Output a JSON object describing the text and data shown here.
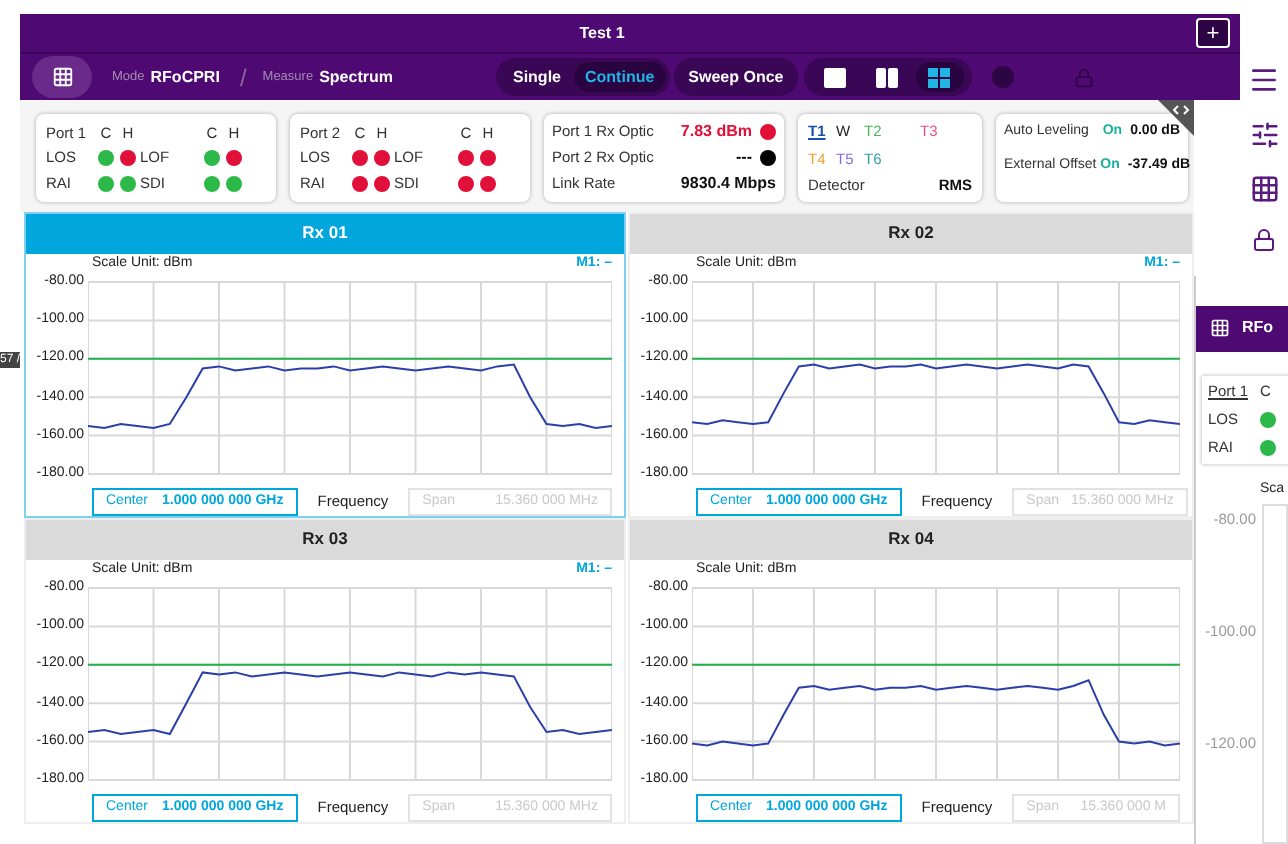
{
  "window": {
    "title": "Test 1",
    "add_button": "+"
  },
  "toolbar": {
    "mode_label": "Mode",
    "mode": "RFoCPRI",
    "separator": "/",
    "measure_label": "Measure",
    "measure": "Spectrum",
    "sweep_modes": [
      {
        "label": "Single",
        "selected": false
      },
      {
        "label": "Continue",
        "selected": true
      }
    ],
    "sweep_once": "Sweep Once",
    "layouts": [
      {
        "kind": "single",
        "selected": false
      },
      {
        "kind": "dual",
        "selected": false
      },
      {
        "kind": "quad",
        "selected": true
      }
    ]
  },
  "port_cards": [
    {
      "port": "Port 1",
      "headers": [
        "C",
        "H",
        "C",
        "H"
      ],
      "alarms": [
        {
          "label": "LOS",
          "dots": [
            {
              "color": "#2db84a"
            },
            {
              "color": "#e0103a"
            }
          ]
        },
        {
          "label": "LOF",
          "dots": [
            {
              "color": "#2db84a"
            },
            {
              "color": "#e0103a"
            }
          ]
        },
        {
          "label": "RAI",
          "dots": [
            {
              "color": "#2db84a"
            },
            {
              "color": "#2db84a"
            }
          ]
        },
        {
          "label": "SDI",
          "dots": [
            {
              "color": "#2db84a"
            },
            {
              "color": "#2db84a"
            }
          ]
        }
      ]
    },
    {
      "port": "Port 2",
      "headers": [
        "C",
        "H",
        "C",
        "H"
      ],
      "alarms": [
        {
          "label": "LOS",
          "dots": [
            {
              "color": "#e0103a"
            },
            {
              "color": "#e0103a"
            }
          ]
        },
        {
          "label": "LOF",
          "dots": [
            {
              "color": "#e0103a"
            },
            {
              "color": "#e0103a"
            }
          ]
        },
        {
          "label": "RAI",
          "dots": [
            {
              "color": "#e0103a"
            },
            {
              "color": "#e0103a"
            }
          ]
        },
        {
          "label": "SDI",
          "dots": [
            {
              "color": "#e0103a"
            },
            {
              "color": "#e0103a"
            }
          ]
        }
      ]
    }
  ],
  "optics": {
    "rows": [
      {
        "label": "Port 1 Rx Optic",
        "value": "7.83 dBm",
        "color": "#e0103a"
      },
      {
        "label": "Port 2 Rx Optic",
        "value": "---",
        "color": "#000000"
      }
    ],
    "link_rate_label": "Link Rate",
    "link_rate": "9830.4 Mbps"
  },
  "traces": {
    "items": [
      {
        "label": "T1",
        "color": "#1a4fb0",
        "selected": true
      },
      {
        "label": "W",
        "color": "#222222",
        "selected": false
      },
      {
        "label": "T2",
        "color": "#46b85a",
        "selected": false
      },
      {
        "label": "T3",
        "color": "#e8508a",
        "selected": false
      },
      {
        "label": "T4",
        "color": "#f0a030",
        "selected": false
      },
      {
        "label": "T5",
        "color": "#8a6ae0",
        "selected": false
      },
      {
        "label": "T6",
        "color": "#30a0b0",
        "selected": false
      }
    ],
    "detector_label": "Detector",
    "detector": "RMS"
  },
  "levels": [
    {
      "label": "Auto Leveling",
      "state": "On",
      "value": "0.00 dB"
    },
    {
      "label": "External Offset",
      "state": "On",
      "value": "-37.49 dB"
    }
  ],
  "charts": [
    {
      "title": "Rx 01",
      "selected": true,
      "scale_unit": "Scale Unit: dBm",
      "marker": "M1: –",
      "chart_data": {
        "type": "line",
        "ylim": [
          -180,
          -80
        ],
        "yticks": [
          {
            "value": -80,
            "label": "-80.00"
          },
          {
            "value": -100,
            "label": "-100.00"
          },
          {
            "value": -120,
            "label": "-120.00"
          },
          {
            "value": -140,
            "label": "-140.00"
          },
          {
            "value": -160,
            "label": "-160.00"
          },
          {
            "value": -180,
            "label": "-180.00"
          }
        ],
        "grid": true,
        "series": [
          {
            "color": "#22b04a",
            "values": [
              -120,
              -120,
              -120,
              -120,
              -120,
              -120,
              -120,
              -120,
              -120,
              -120,
              -120,
              -120,
              -120,
              -120,
              -120,
              -120,
              -120,
              -120,
              -120,
              -120,
              -120,
              -120,
              -120,
              -120,
              -120,
              -120,
              -120,
              -120,
              -120,
              -120,
              -120,
              -120,
              -120
            ]
          },
          {
            "color": "#2a3fa8",
            "values": [
              -155,
              -156,
              -154,
              -155,
              -156,
              -154,
              -140,
              -125,
              -124,
              -126,
              -125,
              -124,
              -126,
              -125,
              -125,
              -124,
              -126,
              -125,
              -124,
              -125,
              -126,
              -125,
              -124,
              -125,
              -126,
              -124,
              -123,
              -140,
              -154,
              -155,
              -154,
              -156,
              -155
            ]
          }
        ]
      },
      "center_label": "Center",
      "center_value": "1.000 000 000 GHz",
      "axis_label": "Frequency",
      "span_label": "Span",
      "span_value": "15.360 000 MHz"
    },
    {
      "title": "Rx 02",
      "selected": false,
      "scale_unit": "Scale Unit: dBm",
      "marker": "M1: –",
      "chart_data": {
        "type": "line",
        "ylim": [
          -180,
          -80
        ],
        "yticks": [
          {
            "value": -80,
            "label": "-80.00"
          },
          {
            "value": -100,
            "label": "-100.00"
          },
          {
            "value": -120,
            "label": "-120.00"
          },
          {
            "value": -140,
            "label": "-140.00"
          },
          {
            "value": -160,
            "label": "-160.00"
          },
          {
            "value": -180,
            "label": "-180.00"
          }
        ],
        "grid": true,
        "series": [
          {
            "color": "#22b04a",
            "values": [
              -120,
              -120,
              -120,
              -120,
              -120,
              -120,
              -120,
              -120,
              -120,
              -120,
              -120,
              -120,
              -120,
              -120,
              -120,
              -120,
              -120,
              -120,
              -120,
              -120,
              -120,
              -120,
              -120,
              -120,
              -120,
              -120,
              -120,
              -120,
              -120,
              -120,
              -120,
              -120,
              -120
            ]
          },
          {
            "color": "#2a3fa8",
            "values": [
              -153,
              -154,
              -152,
              -153,
              -154,
              -153,
              -138,
              -124,
              -123,
              -125,
              -124,
              -123,
              -125,
              -124,
              -124,
              -123,
              -125,
              -124,
              -123,
              -124,
              -125,
              -124,
              -123,
              -124,
              -125,
              -123,
              -124,
              -138,
              -153,
              -154,
              -152,
              -153,
              -154
            ]
          }
        ]
      },
      "center_label": "Center",
      "center_value": "1.000 000 000 GHz",
      "axis_label": "Frequency",
      "span_label": "Span",
      "span_value": "15.360 000 MHz"
    },
    {
      "title": "Rx 03",
      "selected": false,
      "scale_unit": "Scale Unit: dBm",
      "marker": "M1: –",
      "chart_data": {
        "type": "line",
        "ylim": [
          -180,
          -80
        ],
        "yticks": [
          {
            "value": -80,
            "label": "-80.00"
          },
          {
            "value": -100,
            "label": "-100.00"
          },
          {
            "value": -120,
            "label": "-120.00"
          },
          {
            "value": -140,
            "label": "-140.00"
          },
          {
            "value": -160,
            "label": "-160.00"
          },
          {
            "value": -180,
            "label": "-180.00"
          }
        ],
        "grid": true,
        "series": [
          {
            "color": "#22b04a",
            "values": [
              -120,
              -120,
              -120,
              -120,
              -120,
              -120,
              -120,
              -120,
              -120,
              -120,
              -120,
              -120,
              -120,
              -120,
              -120,
              -120,
              -120,
              -120,
              -120,
              -120,
              -120,
              -120,
              -120,
              -120,
              -120,
              -120,
              -120,
              -120,
              -120,
              -120,
              -120,
              -120,
              -120
            ]
          },
          {
            "color": "#2a3fa8",
            "values": [
              -155,
              -154,
              -156,
              -155,
              -154,
              -156,
              -140,
              -124,
              -125,
              -124,
              -126,
              -125,
              -124,
              -125,
              -126,
              -125,
              -124,
              -125,
              -126,
              -124,
              -125,
              -126,
              -124,
              -125,
              -124,
              -125,
              -126,
              -142,
              -155,
              -154,
              -156,
              -155,
              -154
            ]
          }
        ]
      },
      "center_label": "Center",
      "center_value": "1.000 000 000 GHz",
      "axis_label": "Frequency",
      "span_label": "Span",
      "span_value": "15.360 000 MHz"
    },
    {
      "title": "Rx 04",
      "selected": false,
      "scale_unit": "Scale Unit: dBm",
      "chart_data": {
        "type": "line",
        "ylim": [
          -180,
          -80
        ],
        "yticks": [
          {
            "value": -80,
            "label": "-80.00"
          },
          {
            "value": -100,
            "label": "-100.00"
          },
          {
            "value": -120,
            "label": "-120.00"
          },
          {
            "value": -140,
            "label": "-140.00"
          },
          {
            "value": -160,
            "label": "-160.00"
          },
          {
            "value": -180,
            "label": "-180.00"
          }
        ],
        "grid": true,
        "series": [
          {
            "color": "#22b04a",
            "values": [
              -120,
              -120,
              -120,
              -120,
              -120,
              -120,
              -120,
              -120,
              -120,
              -120,
              -120,
              -120,
              -120,
              -120,
              -120,
              -120,
              -120,
              -120,
              -120,
              -120,
              -120,
              -120,
              -120,
              -120,
              -120,
              -120,
              -120,
              -120,
              -120,
              -120,
              -120,
              -120,
              -120
            ]
          },
          {
            "color": "#2a3fa8",
            "values": [
              -161,
              -162,
              -160,
              -161,
              -162,
              -161,
              -146,
              -132,
              -131,
              -133,
              -132,
              -131,
              -133,
              -132,
              -132,
              -131,
              -133,
              -132,
              -131,
              -132,
              -133,
              -132,
              -131,
              -132,
              -133,
              -131,
              -128,
              -146,
              -160,
              -161,
              -160,
              -162,
              -161
            ]
          }
        ]
      },
      "center_label": "Center",
      "center_value": "1.000 000 000 GHz",
      "axis_label": "Frequency",
      "span_label": "Span",
      "span_value": "15.360 000 M"
    }
  ],
  "side_window": {
    "mode": "RFo",
    "port": "Port 1",
    "header": "C",
    "alarms": [
      {
        "label": "LOS",
        "color": "#2db84a"
      },
      {
        "label": "RAI",
        "color": "#2db84a"
      }
    ],
    "scale": "Sca",
    "yticks": [
      "-80.00",
      "-100.00",
      "-120.00"
    ]
  },
  "background_window": {
    "tag": "57 /"
  }
}
